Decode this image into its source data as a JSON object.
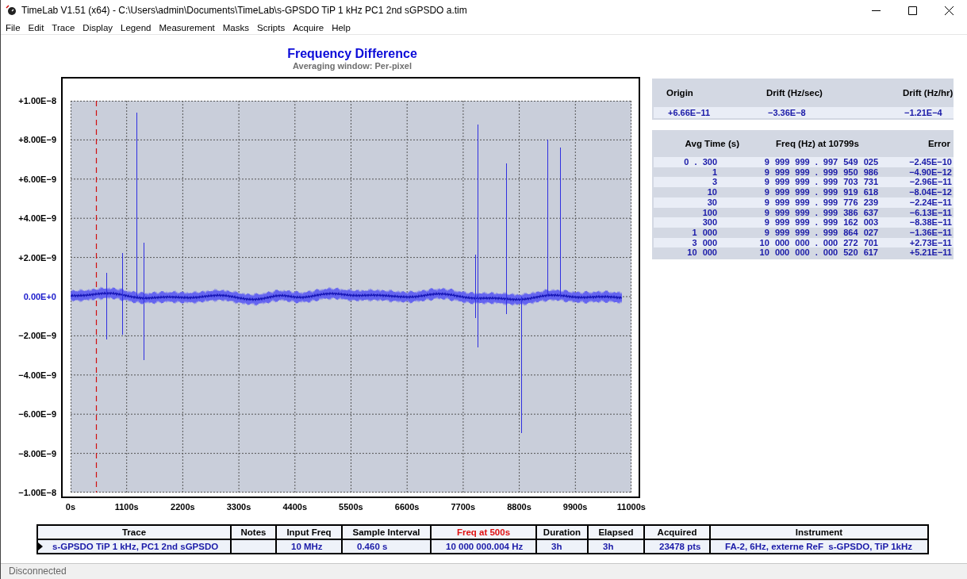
{
  "window": {
    "title": "TimeLab V1.51 (x64) - C:\\Users\\admin\\Documents\\TimeLab\\s-GPSDO TiP 1 kHz PC1 2nd sGPSDO a.tim"
  },
  "menu": [
    "File",
    "Edit",
    "Trace",
    "Display",
    "Legend",
    "Measurement",
    "Masks",
    "Scripts",
    "Acquire",
    "Help"
  ],
  "chart": {
    "title": "Frequency Difference",
    "subtitle": "Averaging window: Per-pixel",
    "y_ticks": [
      {
        "label": "+1.00E−8",
        "highlighted": false
      },
      {
        "label": "+8.00E−9",
        "highlighted": false
      },
      {
        "label": "+6.00E−9",
        "highlighted": false
      },
      {
        "label": "+4.00E−9",
        "highlighted": false
      },
      {
        "label": "+2.00E−9",
        "highlighted": false
      },
      {
        "label": "0.00E+0",
        "highlighted": true
      },
      {
        "label": "−2.00E−9",
        "highlighted": false
      },
      {
        "label": "−4.00E−9",
        "highlighted": false
      },
      {
        "label": "−6.00E−9",
        "highlighted": false
      },
      {
        "label": "−8.00E−9",
        "highlighted": false
      },
      {
        "label": "−1.00E−8",
        "highlighted": false
      }
    ],
    "x_ticks": [
      "0s",
      "1100s",
      "2200s",
      "3300s",
      "4400s",
      "5500s",
      "6600s",
      "7700s",
      "8800s",
      "9900s",
      "11000s"
    ]
  },
  "drift": {
    "columns": [
      "Origin",
      "Drift (Hz/sec)",
      "Drift (Hz/hr)"
    ],
    "values": [
      "+6.66E−11",
      "−3.36E−8",
      "−1.21E−4"
    ]
  },
  "averages": {
    "columns": [
      "Avg Time (s)",
      "Freq (Hz) at 10799s",
      "Error"
    ],
    "rows": [
      [
        "0 . 300",
        "9 999 999 . 997 549 025",
        "−2.45E−10"
      ],
      [
        "1",
        "9 999 999 . 999 950 986",
        "−4.90E−12"
      ],
      [
        "3",
        "9 999 999 . 999 703 731",
        "−2.96E−11"
      ],
      [
        "10",
        "9 999 999 . 999 919 618",
        "−8.04E−12"
      ],
      [
        "30",
        "9 999 999 . 999 776 239",
        "−2.24E−11"
      ],
      [
        "100",
        "9 999 999 . 999 386 637",
        "−6.13E−11"
      ],
      [
        "300",
        "9 999 999 . 999 162 003",
        "−8.38E−11"
      ],
      [
        "1 000",
        "9 999 999 . 999 864 027",
        "−1.36E−11"
      ],
      [
        "3 000",
        "10 000 000 . 000 272 701",
        "+2.73E−11"
      ],
      [
        "10 000",
        "10 000 000 . 000 520 617",
        "+5.21E−11"
      ]
    ]
  },
  "trace_table": {
    "columns": [
      {
        "label": "Trace",
        "highlighted": false
      },
      {
        "label": "Notes",
        "highlighted": false
      },
      {
        "label": "Input Freq",
        "highlighted": false
      },
      {
        "label": "Sample Interval",
        "highlighted": false
      },
      {
        "label": "Freq at 500s",
        "highlighted": true
      },
      {
        "label": "Duration",
        "highlighted": false
      },
      {
        "label": "Elapsed",
        "highlighted": false
      },
      {
        "label": "Acquired",
        "highlighted": false
      },
      {
        "label": "Instrument",
        "highlighted": false
      }
    ],
    "rows": [
      {
        "selected": true,
        "cells": [
          "s-GPSDO TiP 1 kHz, PC1 2nd sGPSDO",
          "",
          "10 MHz",
          "0.460 s",
          "10 000 000.004 Hz",
          "3h",
          "3h",
          "23478 pts",
          "FA-2, 6Hz, externe ReF  s-GPSDO, TiP 1kHz"
        ]
      }
    ]
  },
  "status_bar": {
    "text": "Disconnected"
  }
}
